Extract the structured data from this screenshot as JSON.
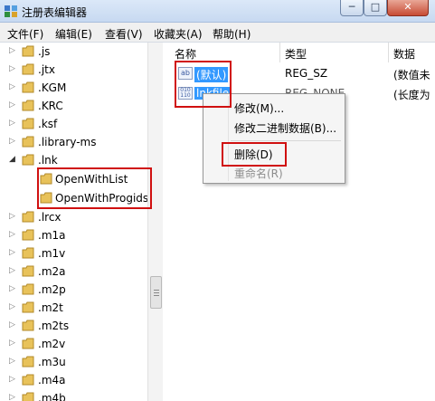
{
  "window": {
    "title": "注册表编辑器",
    "min_glyph": "─",
    "max_glyph": "□",
    "close_glyph": "✕"
  },
  "menu": [
    "文件(F)",
    "编辑(E)",
    "查看(V)",
    "收藏夹(A)",
    "帮助(H)"
  ],
  "tree": {
    "items": [
      {
        "label": ".js",
        "expanded": false
      },
      {
        "label": ".jtx",
        "expanded": false
      },
      {
        "label": ".KGM",
        "expanded": false
      },
      {
        "label": ".KRC",
        "expanded": false
      },
      {
        "label": ".ksf",
        "expanded": false
      },
      {
        "label": ".library-ms",
        "expanded": false
      },
      {
        "label": ".lnk",
        "expanded": true
      },
      {
        "label": "OpenWithList",
        "child": true
      },
      {
        "label": "OpenWithProgids",
        "child": true
      },
      {
        "label": ".lrcx",
        "expanded": false
      },
      {
        "label": ".m1a",
        "expanded": false
      },
      {
        "label": ".m1v",
        "expanded": false
      },
      {
        "label": ".m2a",
        "expanded": false
      },
      {
        "label": ".m2p",
        "expanded": false
      },
      {
        "label": ".m2t",
        "expanded": false
      },
      {
        "label": ".m2ts",
        "expanded": false
      },
      {
        "label": ".m2v",
        "expanded": false
      },
      {
        "label": ".m3u",
        "expanded": false
      },
      {
        "label": ".m4a",
        "expanded": false
      },
      {
        "label": ".m4b",
        "expanded": false
      }
    ]
  },
  "values": {
    "headers": {
      "name": "名称",
      "type": "类型",
      "data": "数据"
    },
    "rows": [
      {
        "name": "(默认)",
        "type": "REG_SZ",
        "data": "(数值未",
        "icon": "ab"
      },
      {
        "name": "lnkfile",
        "type": "REG_NONE",
        "data": "(长度为",
        "icon": "binary"
      }
    ]
  },
  "context_menu": {
    "items": [
      "修改(M)...",
      "修改二进制数据(B)...",
      "删除(D)",
      "重命名(R)"
    ],
    "disabled_item": "重命名(R)"
  },
  "colors": {
    "selection": "#3399ff",
    "highlight_box": "#d01010",
    "folder": "#e8c25a"
  }
}
